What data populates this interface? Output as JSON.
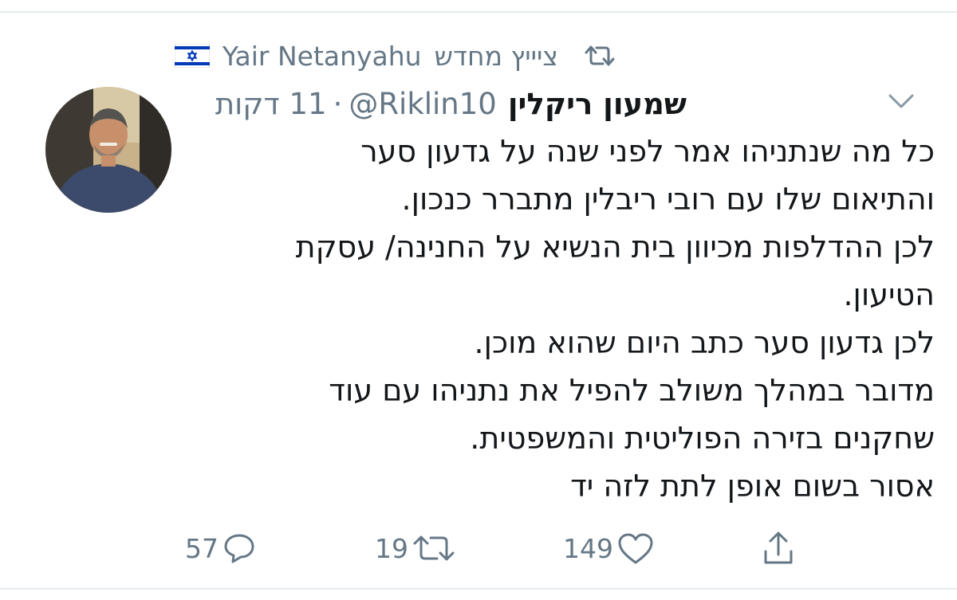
{
  "retweet_context": {
    "icon": "retweet-icon",
    "label": "ציייץ מחדש",
    "user": "Yair Netanyahu",
    "flag": "israel-flag-icon"
  },
  "tweet": {
    "display_name": "שמעון ריקלין",
    "handle": "@Riklin10",
    "separator": "·",
    "time": "11 דקות",
    "lines": [
      "כל מה שנתניהו אמר לפני שנה על גדעון סער",
      "והתיאום שלו עם רובי ריבלין מתברר כנכון.",
      "לכן ההדלפות מכיוון בית הנשיא על החנינה/ עסקת",
      "הטיעון.",
      "לכן גדעון סער כתב היום שהוא מוכן.",
      "מדובר במהלך משולב להפיל את נתניהו עם עוד",
      "שחקנים בזירה הפוליטית והמשפטית.",
      "אסור בשום אופן לתת לזה יד"
    ]
  },
  "actions": {
    "reply_count": "57",
    "retweet_count": "19",
    "like_count": "149"
  },
  "colors": {
    "secondary_text": "#657786",
    "primary_text": "#14171a",
    "divider": "#e6ecf0",
    "flag_blue": "#0038b8"
  }
}
